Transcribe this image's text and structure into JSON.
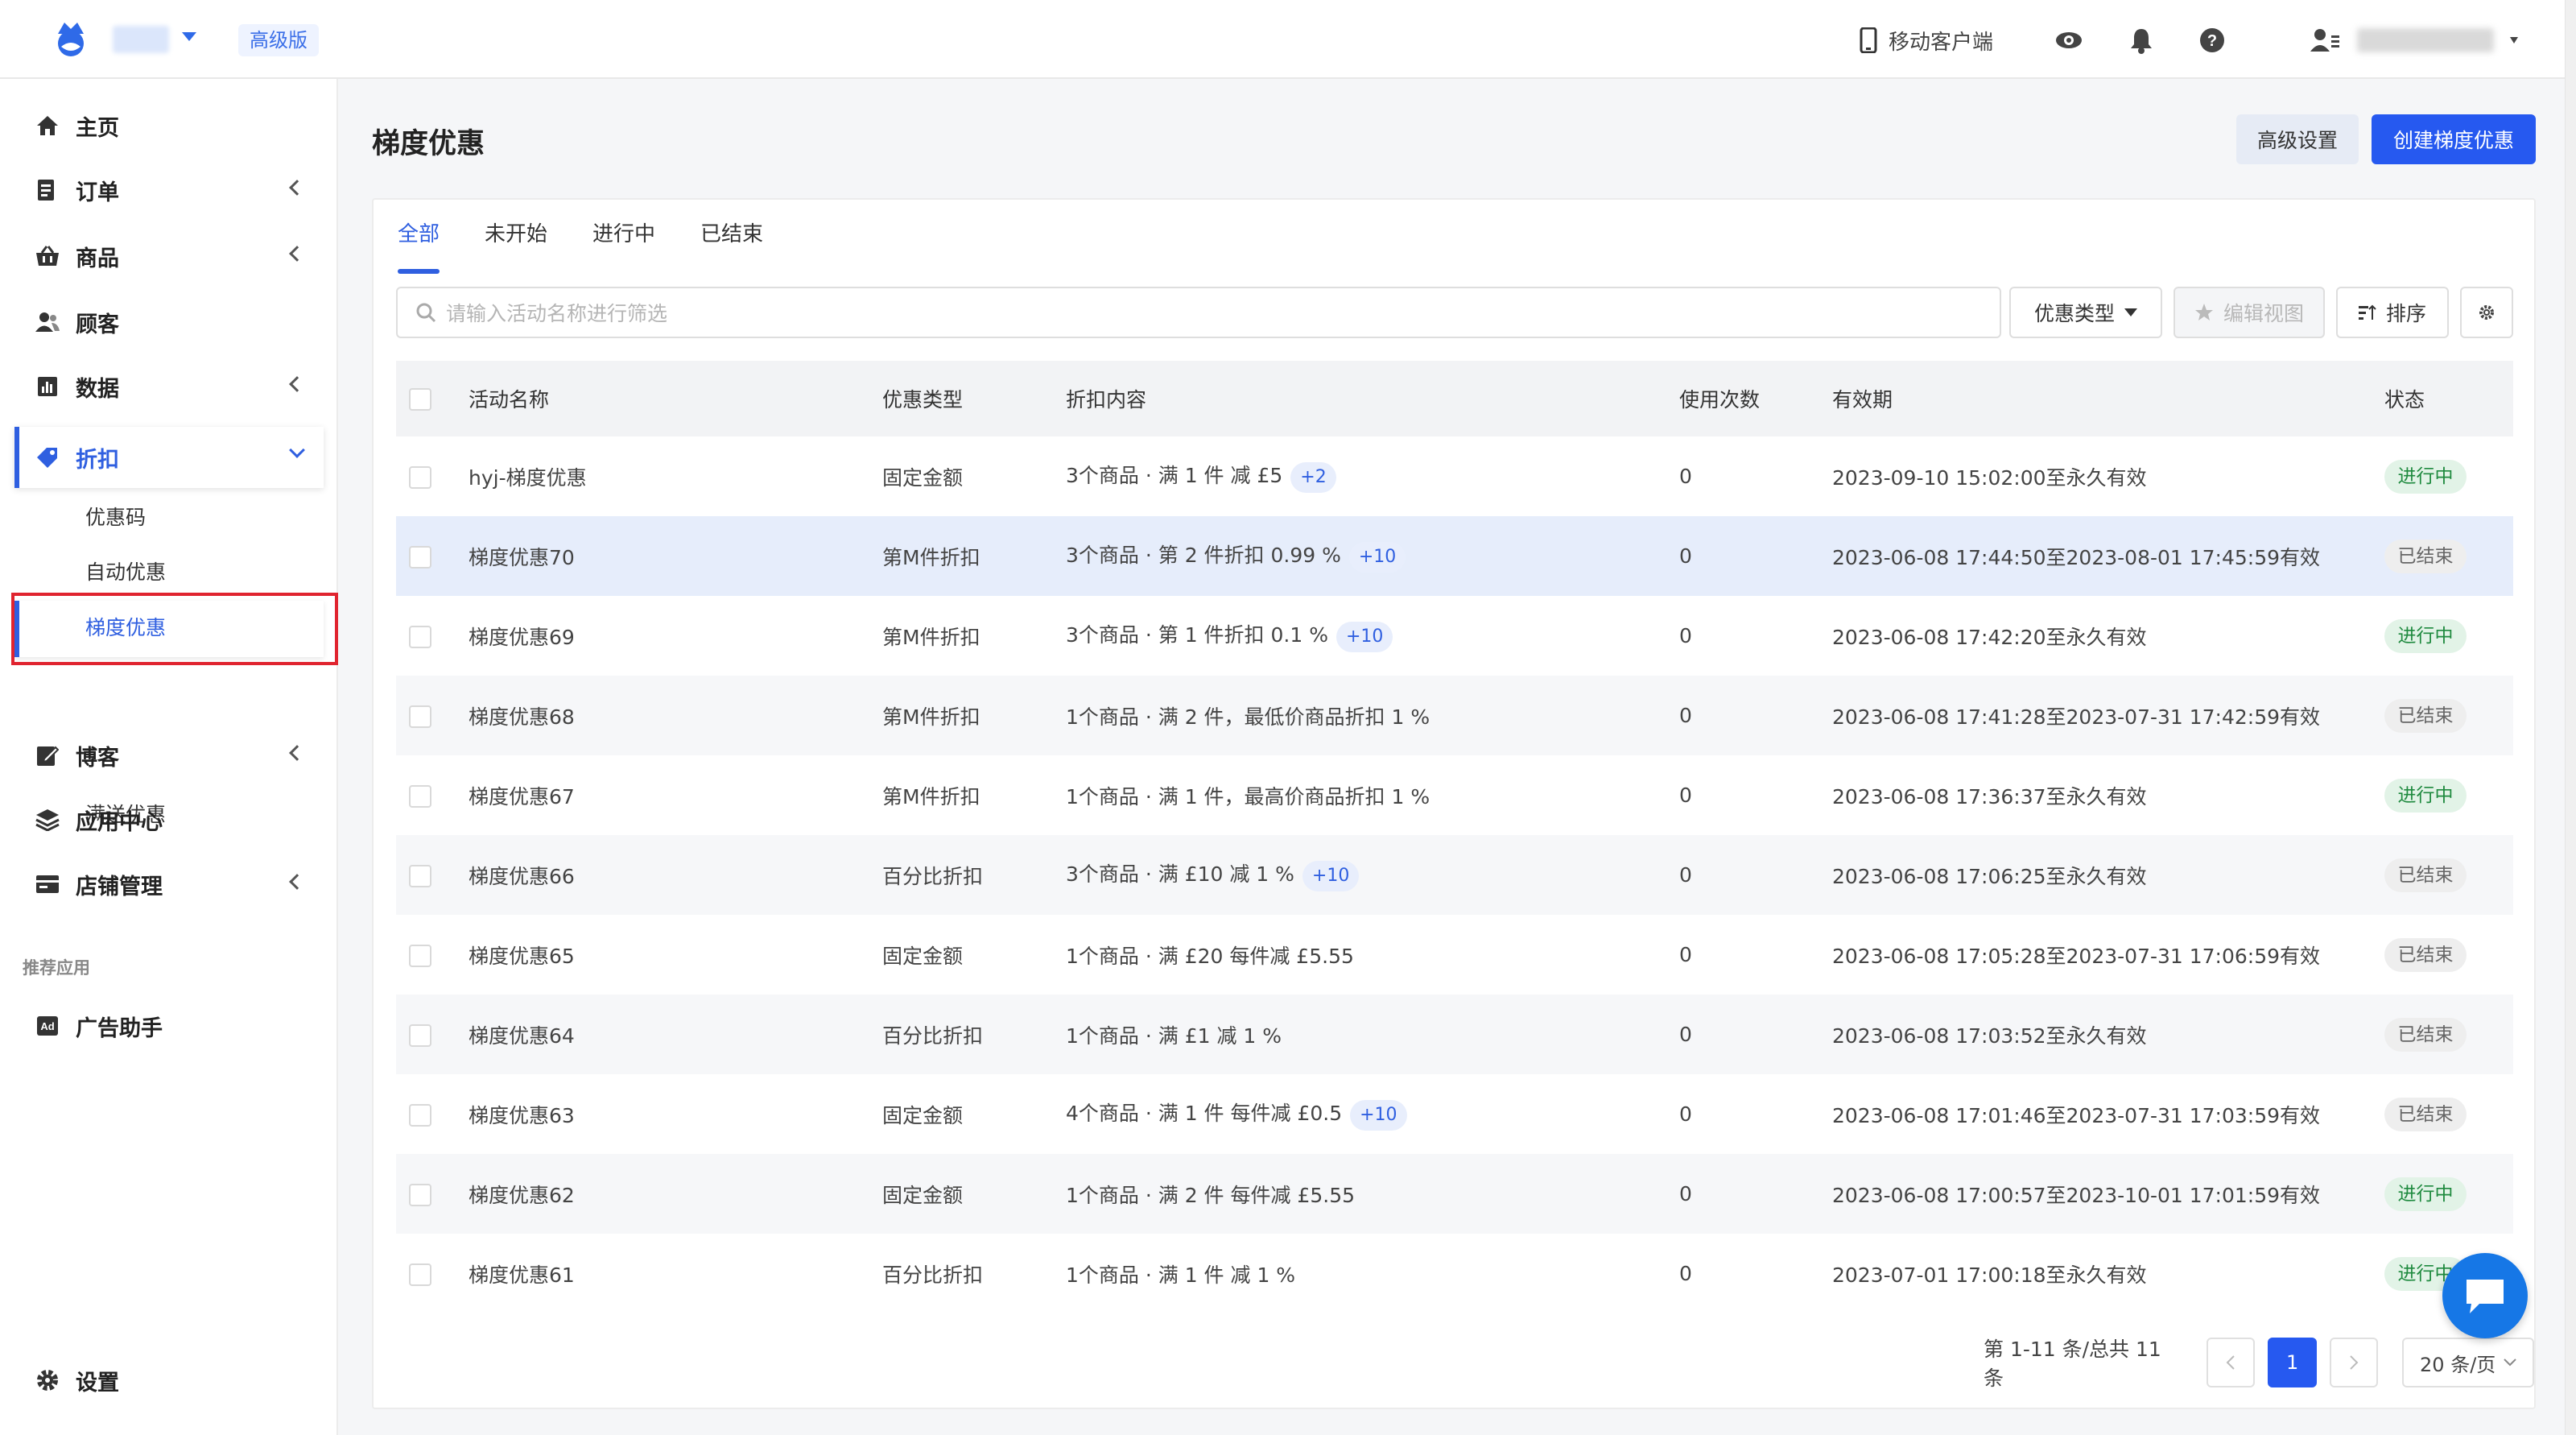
{
  "header": {
    "plan_badge": "高级版",
    "mobile_link": "移动客户端"
  },
  "sidebar": {
    "items": [
      {
        "label": "主页",
        "icon": "home-icon"
      },
      {
        "label": "订单",
        "icon": "order-icon"
      },
      {
        "label": "商品",
        "icon": "basket-icon"
      },
      {
        "label": "顾客",
        "icon": "users-icon"
      },
      {
        "label": "数据",
        "icon": "chart-icon"
      },
      {
        "label": "折扣",
        "icon": "tag-icon"
      },
      {
        "label": "博客",
        "icon": "edit-icon"
      },
      {
        "label": "应用中心",
        "icon": "layers-icon"
      },
      {
        "label": "店铺管理",
        "icon": "store-icon"
      }
    ],
    "sub_items": [
      "优惠码",
      "自动优惠",
      "梯度优惠",
      "满送优惠"
    ],
    "section_label": "推荐应用",
    "ad_helper": "广告助手",
    "settings": "设置"
  },
  "page": {
    "title": "梯度优惠",
    "advanced_settings": "高级设置",
    "create_button": "创建梯度优惠"
  },
  "tabs": [
    "全部",
    "未开始",
    "进行中",
    "已结束"
  ],
  "toolbar": {
    "search_placeholder": "请输入活动名称进行筛选",
    "discount_type": "优惠类型",
    "edit_view": "编辑视图",
    "sort": "排序"
  },
  "table": {
    "headers": [
      "活动名称",
      "优惠类型",
      "折扣内容",
      "使用次数",
      "有效期",
      "状态"
    ],
    "rows": [
      {
        "name": "hyj-梯度优惠",
        "type": "固定金额",
        "content": "3个商品 · 满 1 件 减 £5",
        "chip": "+2",
        "uses": "0",
        "period": "2023-09-10 15:02:00至永久有效",
        "status": "进行中",
        "active": true
      },
      {
        "name": "梯度优惠70",
        "type": "第M件折扣",
        "content": "3个商品 · 第 2 件折扣 0.99 %",
        "chip": "+10",
        "uses": "0",
        "period": "2023-06-08 17:44:50至2023-08-01 17:45:59有效",
        "status": "已结束",
        "active": false
      },
      {
        "name": "梯度优惠69",
        "type": "第M件折扣",
        "content": "3个商品 · 第 1 件折扣 0.1 %",
        "chip": "+10",
        "uses": "0",
        "period": "2023-06-08 17:42:20至永久有效",
        "status": "进行中",
        "active": true
      },
      {
        "name": "梯度优惠68",
        "type": "第M件折扣",
        "content": "1个商品 · 满 2 件，最低价商品折扣 1 %",
        "chip": "",
        "uses": "0",
        "period": "2023-06-08 17:41:28至2023-07-31 17:42:59有效",
        "status": "已结束",
        "active": false
      },
      {
        "name": "梯度优惠67",
        "type": "第M件折扣",
        "content": "1个商品 · 满 1 件，最高价商品折扣 1 %",
        "chip": "",
        "uses": "0",
        "period": "2023-06-08 17:36:37至永久有效",
        "status": "进行中",
        "active": true
      },
      {
        "name": "梯度优惠66",
        "type": "百分比折扣",
        "content": "3个商品 · 满 £10 减 1 %",
        "chip": "+10",
        "uses": "0",
        "period": "2023-06-08 17:06:25至永久有效",
        "status": "已结束",
        "active": false
      },
      {
        "name": "梯度优惠65",
        "type": "固定金额",
        "content": "1个商品 · 满 £20 每件减 £5.55",
        "chip": "",
        "uses": "0",
        "period": "2023-06-08 17:05:28至2023-07-31 17:06:59有效",
        "status": "已结束",
        "active": false
      },
      {
        "name": "梯度优惠64",
        "type": "百分比折扣",
        "content": "1个商品 · 满 £1 减 1 %",
        "chip": "",
        "uses": "0",
        "period": "2023-06-08 17:03:52至永久有效",
        "status": "已结束",
        "active": false
      },
      {
        "name": "梯度优惠63",
        "type": "固定金额",
        "content": "4个商品 · 满 1 件 每件减 £0.5",
        "chip": "+10",
        "uses": "0",
        "period": "2023-06-08 17:01:46至2023-07-31 17:03:59有效",
        "status": "已结束",
        "active": false
      },
      {
        "name": "梯度优惠62",
        "type": "固定金额",
        "content": "1个商品 · 满 2 件 每件减 £5.55",
        "chip": "",
        "uses": "0",
        "period": "2023-06-08 17:00:57至2023-10-01 17:01:59有效",
        "status": "进行中",
        "active": true
      },
      {
        "name": "梯度优惠61",
        "type": "百分比折扣",
        "content": "1个商品 · 满 1 件 减 1 %",
        "chip": "",
        "uses": "0",
        "period": "2023-07-01 17:00:18至永久有效",
        "status": "进行中",
        "active": true
      }
    ]
  },
  "pagination": {
    "info": "第 1-11 条/总共 11 条",
    "current": "1",
    "page_size": "20 条/页"
  },
  "colors": {
    "primary": "#2659f0",
    "highlight_box": "#e0242f",
    "status_on": "#1f8a3f"
  }
}
